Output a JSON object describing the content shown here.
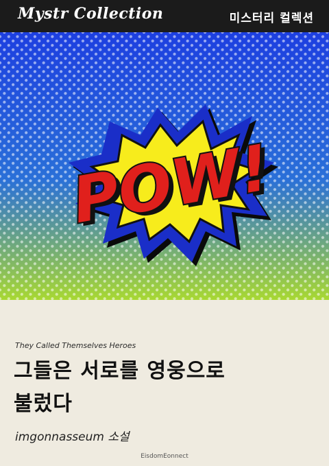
{
  "header": {
    "series_name": "Mystr Collection",
    "series_label_ko": "미스터리 컬렉션"
  },
  "illustration": {
    "text": "POW!",
    "colors": {
      "sky_top": "#1d3fe0",
      "sky_bottom": "#a8d832",
      "burst_outer": "#1a2ec8",
      "burst_inner": "#f7ec1c",
      "letters": "#e0201c"
    }
  },
  "book": {
    "subtitle_en": "They Called Themselves Heroes",
    "title_line1": "그들은 서로를 영웅으로",
    "title_line2": "불렀다",
    "author": "imgonnasseum 소설",
    "publisher": "EisdomEonnect"
  }
}
